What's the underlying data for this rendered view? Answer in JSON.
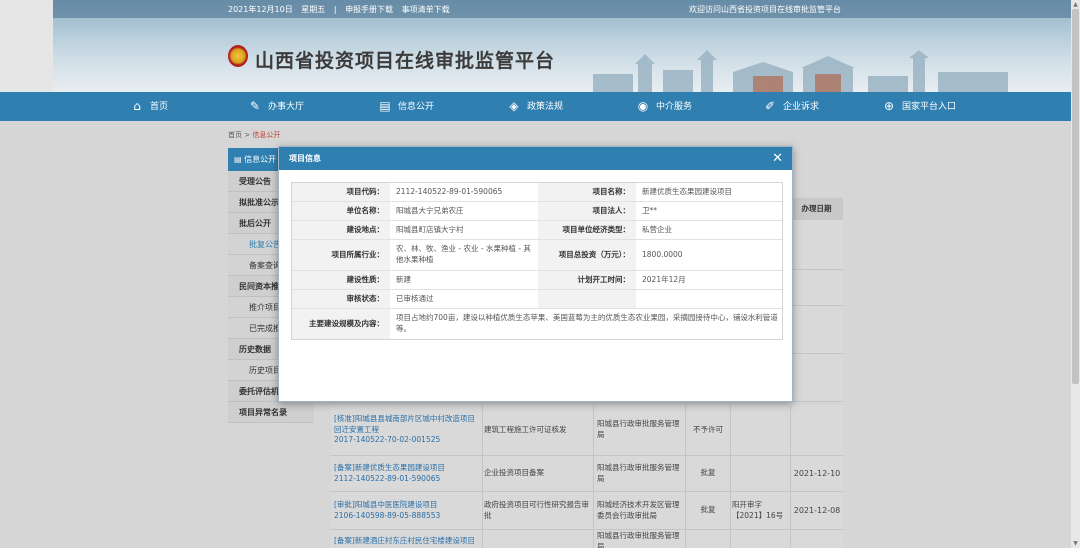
{
  "topbar": {
    "date": "2021年12月10日",
    "weekday": "星期五",
    "links": [
      "申报手册下载",
      "事项清单下载"
    ],
    "welcome": "欢迎访问山西省投资项目在线审批监管平台"
  },
  "site": {
    "title": "山西省投资项目在线审批监管平台"
  },
  "nav": [
    {
      "label": "首页",
      "icon": "home-icon",
      "glyph": "⌂"
    },
    {
      "label": "办事大厅",
      "icon": "pen-icon",
      "glyph": "✎"
    },
    {
      "label": "信息公开",
      "icon": "document-icon",
      "glyph": "▤"
    },
    {
      "label": "政策法规",
      "icon": "layers-icon",
      "glyph": "◈"
    },
    {
      "label": "中介服务",
      "icon": "compass-icon",
      "glyph": "◉"
    },
    {
      "label": "企业诉求",
      "icon": "edit-icon",
      "glyph": "✐"
    },
    {
      "label": "国家平台入口",
      "icon": "globe-icon",
      "glyph": "⊕"
    }
  ],
  "breadcrumb": {
    "home": "首页",
    "sep": ">",
    "current": "信息公开"
  },
  "sidebar": {
    "title": "信息公开",
    "items": [
      {
        "label": "受理公告",
        "sub": false
      },
      {
        "label": "拟批准公示",
        "sub": false
      },
      {
        "label": "批后公开",
        "sub": false
      },
      {
        "label": "批复公告",
        "sub": true,
        "active": true
      },
      {
        "label": "备案查询",
        "sub": true
      },
      {
        "label": "民间资本推介",
        "sub": false
      },
      {
        "label": "推介项目",
        "sub": true
      },
      {
        "label": "已完成推介",
        "sub": true
      },
      {
        "label": "历史数据",
        "sub": false
      },
      {
        "label": "历史项目",
        "sub": true
      },
      {
        "label": "委托评估机构",
        "sub": false,
        "strong": true
      },
      {
        "label": "项目异常名录",
        "sub": false,
        "strong": true
      }
    ]
  },
  "table": {
    "date_header": "办理日期",
    "rows": [
      {
        "name": "[核准]阳城县县城南部片区城中村改造项目回迁安置工程",
        "code": "2017-140522-70-02-001525",
        "item": "建筑工程施工许可证核发",
        "dept": "阳城县行政审批服务管理局",
        "result": "不予许可",
        "doc": "",
        "date": ""
      },
      {
        "name": "[备案]新建优质生态果园建设项目",
        "code": "2112-140522-89-01-590065",
        "item": "企业投资项目备案",
        "dept": "阳城县行政审批服务管理局",
        "result": "批复",
        "doc": "",
        "date": "2021-12-10"
      },
      {
        "name": "[审批]阳城县中医医院建设项目",
        "code": "2106-140598-89-05-888553",
        "item": "政府投资项目可行性研究报告审批",
        "dept": "阳城经济技术开发区管理委员会行政审批局",
        "result": "批复",
        "doc": "阳开审字【2021】16号",
        "date": "2021-12-08"
      },
      {
        "name": "[备案]新建酒庄村东庄村民住宅楼建设项目",
        "code": "",
        "item": "",
        "dept": "阳城县行政审批服务管理局",
        "result": "",
        "doc": "",
        "date": ""
      }
    ]
  },
  "modal": {
    "title": "项目信息",
    "close_glyph": "✕",
    "rows": [
      {
        "l1": "项目代码：",
        "v1": "2112-140522-89-01-590065",
        "l2": "项目名称：",
        "v2": "新建优质生态果园建设项目"
      },
      {
        "l1": "单位名称：",
        "v1": "阳城县大宁兄弟农庄",
        "l2": "项目法人：",
        "v2": "卫**"
      },
      {
        "l1": "建设地点：",
        "v1": "阳城县町店镇大宁村",
        "l2": "项目单位经济类型：",
        "v2": "私营企业"
      },
      {
        "l1": "项目所属行业：",
        "v1": "农、林、牧、渔业 - 农业 - 水果种植 - 其他水果种植",
        "l2": "项目总投资（万元）：",
        "v2": "1800.0000"
      },
      {
        "l1": "建设性质：",
        "v1": "新建",
        "l2": "计划开工时间：",
        "v2": "2021年12月"
      },
      {
        "l1": "审核状态：",
        "v1": "已审核通过",
        "l2": "",
        "v2": ""
      }
    ],
    "scope_label": "主要建设规模及内容：",
    "scope_value": "项目占地约700亩，建设以种植优质生态苹果、美国蓝莓为主的优质生态农业果园，采摘园接待中心，铺设水利管道等。"
  }
}
